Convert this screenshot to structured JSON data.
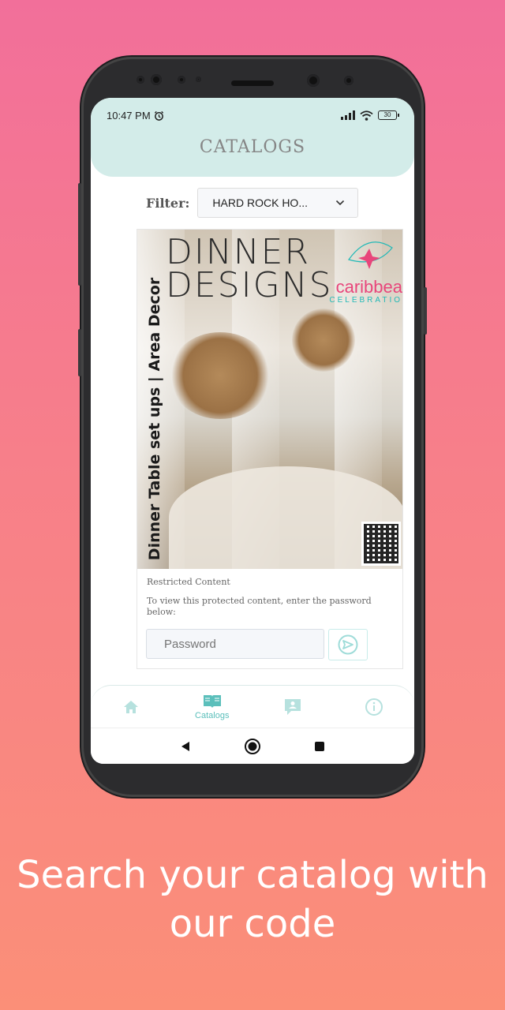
{
  "status_bar": {
    "time": "10:47 PM",
    "battery": "30"
  },
  "header": {
    "title": "CATALOGS"
  },
  "filter": {
    "label": "Filter:",
    "selected": "HARD ROCK HO..."
  },
  "catalog": {
    "cover_title_line1": "DINNER",
    "cover_title_line2": "DESIGNS",
    "cover_subtitle": "Dinner Table set ups | Area Decor",
    "brand_name": "caribbea",
    "brand_sub": "CELEBRATIO"
  },
  "restricted": {
    "title": "Restricted Content",
    "description": "To view this protected content, enter the password below:",
    "password_placeholder": "Password"
  },
  "bottom_nav": {
    "catalogs_label": "Catalogs"
  },
  "tagline": {
    "line1": "Search your catalog with",
    "line2": "our code"
  },
  "colors": {
    "accent": "#5bbfbb",
    "header_bg": "#d3ece9",
    "brand_pink": "#e8457b"
  },
  "icons": [
    "alarm-icon",
    "signal-icon",
    "wifi-icon",
    "chevron-down-icon",
    "send-icon",
    "home-icon",
    "book-icon",
    "chat-icon",
    "info-icon",
    "back-icon",
    "home-circle-icon",
    "recents-icon"
  ]
}
